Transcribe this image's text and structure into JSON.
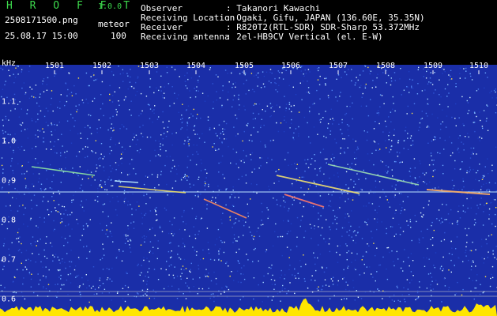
{
  "header": {
    "brand": "H R O F F T",
    "version": "1.0.0",
    "filename": "2508171500.png",
    "mode": "meteor",
    "datetime": "25.08.17 15:00",
    "level": "100",
    "info": [
      {
        "label": "Observer",
        "value": ": Takanori Kawachi"
      },
      {
        "label": "Receiving Location",
        "value": ": Ogaki, Gifu, JAPAN (136.60E, 35.35N)"
      },
      {
        "label": "Receiver",
        "value": ": R820T2(RTL-SDR) SDR-Sharp 53.372MHz"
      },
      {
        "label": "Receiving antenna",
        "value": ": 2el-HB9CV Vertical (el. E-W)"
      }
    ]
  },
  "spectrogram": {
    "unit": "kHz",
    "time_ticks": [
      "1501",
      "1502",
      "1503",
      "1504",
      "1505",
      "1506",
      "1507",
      "1508",
      "1509",
      "1510"
    ],
    "freq_ticks": [
      "1.1",
      "1.0",
      "0.9",
      "0.8",
      "0.7",
      "0.6"
    ],
    "colors": {
      "background": "#1a2ea8",
      "text": "#ffffff",
      "brand": "#3dd94d",
      "baseline": "#ffe600"
    }
  }
}
